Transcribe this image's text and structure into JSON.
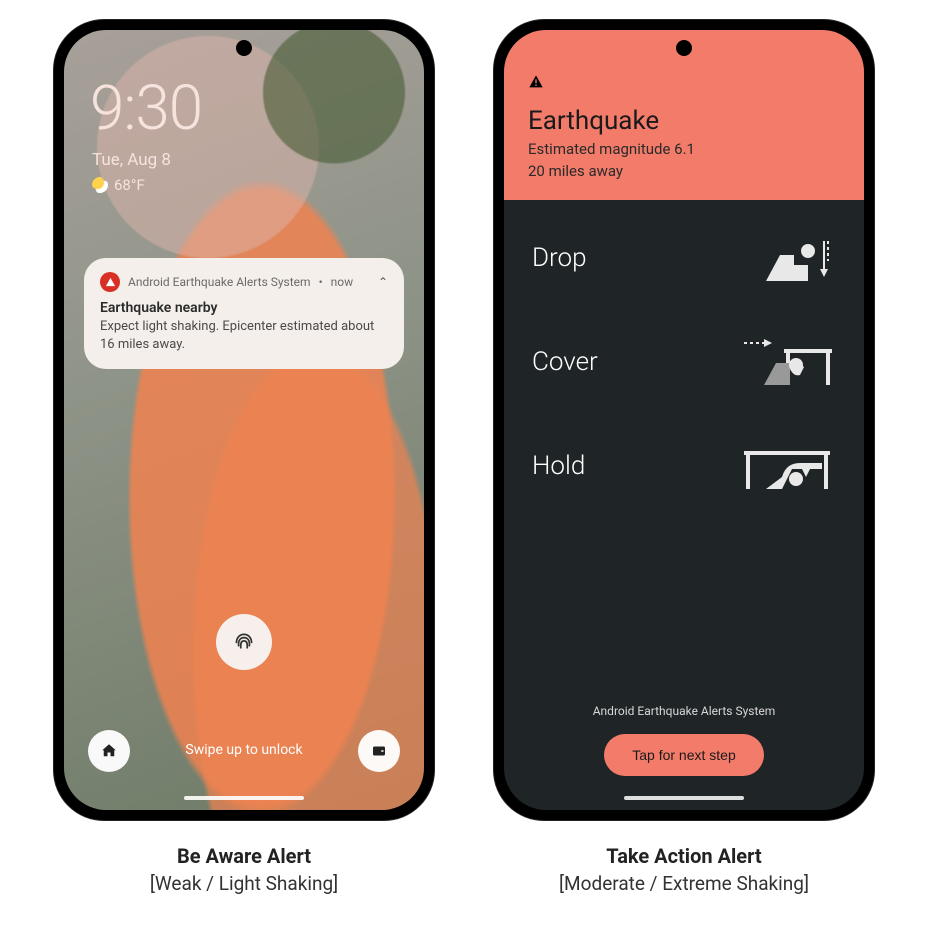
{
  "left": {
    "clock": "9:30",
    "date": "Tue, Aug 8",
    "temperature": "68°F",
    "swipe_hint": "Swipe up to unlock",
    "notification": {
      "app": "Android Earthquake Alerts System",
      "time": "now",
      "title": "Earthquake nearby",
      "body": "Expect light shaking. Epicenter estimated about 16 miles away."
    }
  },
  "right": {
    "title": "Earthquake",
    "magnitude_line": "Estimated magnitude 6.1",
    "distance_line": "20 miles away",
    "steps": [
      {
        "label": "Drop"
      },
      {
        "label": "Cover"
      },
      {
        "label": "Hold"
      }
    ],
    "system_label": "Android Earthquake Alerts System",
    "button": "Tap for next step"
  },
  "captions": {
    "left": {
      "title": "Be Aware Alert",
      "sub": "[Weak / Light Shaking]"
    },
    "right": {
      "title": "Take Action Alert",
      "sub": "[Moderate / Extreme Shaking]"
    }
  }
}
